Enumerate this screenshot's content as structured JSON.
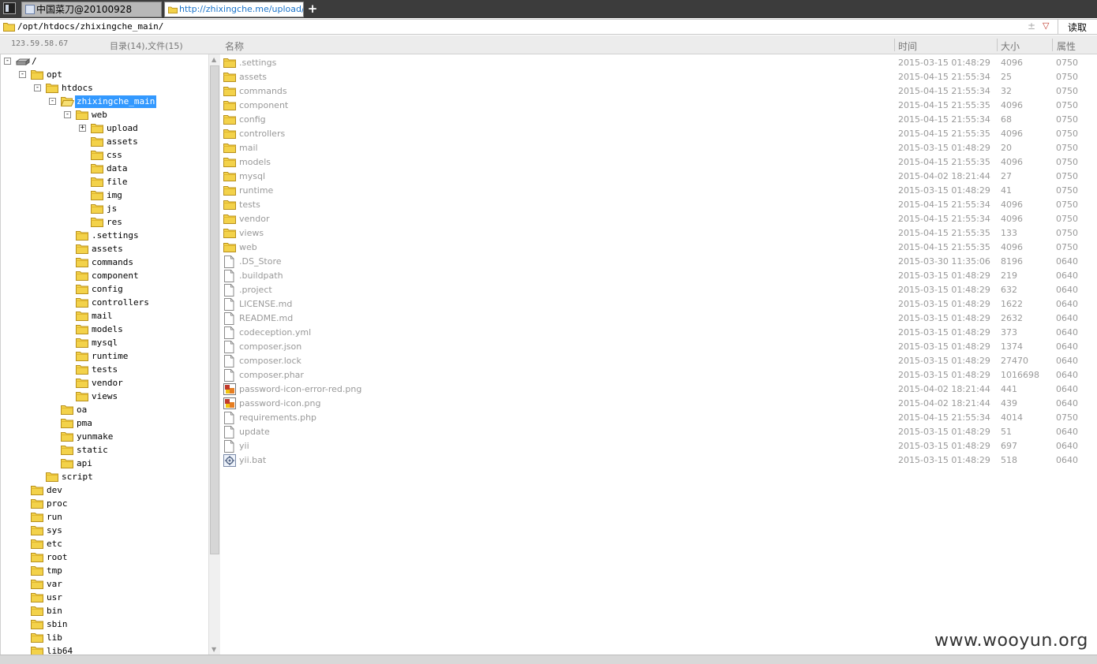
{
  "tabs": [
    {
      "label": "中国菜刀@20100928",
      "active": false
    },
    {
      "label": "http://zhixingche.me/upload/i...",
      "active": true
    }
  ],
  "new_tab_label": "+",
  "address": {
    "path": "/opt/htdocs/zhixingche_main/",
    "read_button": "读取",
    "ctrl_plus": "±",
    "ctrl_dropdown": "▽"
  },
  "left_panel": {
    "ip": "123.59.58.67",
    "counts": "目录(14),文件(15)"
  },
  "tree": [
    {
      "label": "/",
      "expander": "-",
      "icon": "drive"
    },
    {
      "label": "opt",
      "expander": "-",
      "icon": "folder"
    },
    {
      "label": "htdocs",
      "expander": "-",
      "icon": "folder"
    },
    {
      "label": "zhixingche_main",
      "expander": "-",
      "icon": "folder-open",
      "selected": true
    },
    {
      "label": "web",
      "expander": "-",
      "icon": "folder"
    },
    {
      "label": "upload",
      "expander": "+",
      "icon": "folder"
    },
    {
      "label": "assets",
      "expander": "",
      "icon": "folder"
    },
    {
      "label": "css",
      "expander": "",
      "icon": "folder"
    },
    {
      "label": "data",
      "expander": "",
      "icon": "folder"
    },
    {
      "label": "file",
      "expander": "",
      "icon": "folder"
    },
    {
      "label": "img",
      "expander": "",
      "icon": "folder"
    },
    {
      "label": "js",
      "expander": "",
      "icon": "folder"
    },
    {
      "label": "res",
      "expander": "",
      "icon": "folder"
    },
    {
      "label": ".settings",
      "expander": "",
      "icon": "folder"
    },
    {
      "label": "assets",
      "expander": "",
      "icon": "folder"
    },
    {
      "label": "commands",
      "expander": "",
      "icon": "folder"
    },
    {
      "label": "component",
      "expander": "",
      "icon": "folder"
    },
    {
      "label": "config",
      "expander": "",
      "icon": "folder"
    },
    {
      "label": "controllers",
      "expander": "",
      "icon": "folder"
    },
    {
      "label": "mail",
      "expander": "",
      "icon": "folder"
    },
    {
      "label": "models",
      "expander": "",
      "icon": "folder"
    },
    {
      "label": "mysql",
      "expander": "",
      "icon": "folder"
    },
    {
      "label": "runtime",
      "expander": "",
      "icon": "folder"
    },
    {
      "label": "tests",
      "expander": "",
      "icon": "folder"
    },
    {
      "label": "vendor",
      "expander": "",
      "icon": "folder"
    },
    {
      "label": "views",
      "expander": "",
      "icon": "folder"
    },
    {
      "label": "oa",
      "expander": "",
      "icon": "folder"
    },
    {
      "label": "pma",
      "expander": "",
      "icon": "folder"
    },
    {
      "label": "yunmake",
      "expander": "",
      "icon": "folder"
    },
    {
      "label": "static",
      "expander": "",
      "icon": "folder"
    },
    {
      "label": "api",
      "expander": "",
      "icon": "folder"
    },
    {
      "label": "script",
      "expander": "",
      "icon": "folder"
    },
    {
      "label": "dev",
      "expander": "",
      "icon": "folder"
    },
    {
      "label": "proc",
      "expander": "",
      "icon": "folder"
    },
    {
      "label": "run",
      "expander": "",
      "icon": "folder"
    },
    {
      "label": "sys",
      "expander": "",
      "icon": "folder"
    },
    {
      "label": "etc",
      "expander": "",
      "icon": "folder"
    },
    {
      "label": "root",
      "expander": "",
      "icon": "folder"
    },
    {
      "label": "tmp",
      "expander": "",
      "icon": "folder"
    },
    {
      "label": "var",
      "expander": "",
      "icon": "folder"
    },
    {
      "label": "usr",
      "expander": "",
      "icon": "folder"
    },
    {
      "label": "bin",
      "expander": "",
      "icon": "folder"
    },
    {
      "label": "sbin",
      "expander": "",
      "icon": "folder"
    },
    {
      "label": "lib",
      "expander": "",
      "icon": "folder"
    },
    {
      "label": "lib64",
      "expander": "",
      "icon": "folder"
    }
  ],
  "columns": {
    "name": "名称",
    "time": "时间",
    "size": "大小",
    "attr": "属性"
  },
  "files": [
    {
      "name": ".settings",
      "time": "2015-03-15 01:48:29",
      "size": "4096",
      "attr": "0750",
      "icon": "folder"
    },
    {
      "name": "assets",
      "time": "2015-04-15 21:55:34",
      "size": "25",
      "attr": "0750",
      "icon": "folder"
    },
    {
      "name": "commands",
      "time": "2015-04-15 21:55:34",
      "size": "32",
      "attr": "0750",
      "icon": "folder"
    },
    {
      "name": "component",
      "time": "2015-04-15 21:55:35",
      "size": "4096",
      "attr": "0750",
      "icon": "folder"
    },
    {
      "name": "config",
      "time": "2015-04-15 21:55:34",
      "size": "68",
      "attr": "0750",
      "icon": "folder"
    },
    {
      "name": "controllers",
      "time": "2015-04-15 21:55:35",
      "size": "4096",
      "attr": "0750",
      "icon": "folder"
    },
    {
      "name": "mail",
      "time": "2015-03-15 01:48:29",
      "size": "20",
      "attr": "0750",
      "icon": "folder"
    },
    {
      "name": "models",
      "time": "2015-04-15 21:55:35",
      "size": "4096",
      "attr": "0750",
      "icon": "folder"
    },
    {
      "name": "mysql",
      "time": "2015-04-02 18:21:44",
      "size": "27",
      "attr": "0750",
      "icon": "folder"
    },
    {
      "name": "runtime",
      "time": "2015-03-15 01:48:29",
      "size": "41",
      "attr": "0750",
      "icon": "folder"
    },
    {
      "name": "tests",
      "time": "2015-04-15 21:55:34",
      "size": "4096",
      "attr": "0750",
      "icon": "folder"
    },
    {
      "name": "vendor",
      "time": "2015-04-15 21:55:34",
      "size": "4096",
      "attr": "0750",
      "icon": "folder"
    },
    {
      "name": "views",
      "time": "2015-04-15 21:55:35",
      "size": "133",
      "attr": "0750",
      "icon": "folder"
    },
    {
      "name": "web",
      "time": "2015-04-15 21:55:35",
      "size": "4096",
      "attr": "0750",
      "icon": "folder"
    },
    {
      "name": ".DS_Store",
      "time": "2015-03-30 11:35:06",
      "size": "8196",
      "attr": "0640",
      "icon": "file"
    },
    {
      "name": ".buildpath",
      "time": "2015-03-15 01:48:29",
      "size": "219",
      "attr": "0640",
      "icon": "file"
    },
    {
      "name": ".project",
      "time": "2015-03-15 01:48:29",
      "size": "632",
      "attr": "0640",
      "icon": "file"
    },
    {
      "name": "LICENSE.md",
      "time": "2015-03-15 01:48:29",
      "size": "1622",
      "attr": "0640",
      "icon": "file"
    },
    {
      "name": "README.md",
      "time": "2015-03-15 01:48:29",
      "size": "2632",
      "attr": "0640",
      "icon": "file"
    },
    {
      "name": "codeception.yml",
      "time": "2015-03-15 01:48:29",
      "size": "373",
      "attr": "0640",
      "icon": "file"
    },
    {
      "name": "composer.json",
      "time": "2015-03-15 01:48:29",
      "size": "1374",
      "attr": "0640",
      "icon": "file"
    },
    {
      "name": "composer.lock",
      "time": "2015-03-15 01:48:29",
      "size": "27470",
      "attr": "0640",
      "icon": "file"
    },
    {
      "name": "composer.phar",
      "time": "2015-03-15 01:48:29",
      "size": "1016698",
      "attr": "0640",
      "icon": "file"
    },
    {
      "name": "password-icon-error-red.png",
      "time": "2015-04-02 18:21:44",
      "size": "441",
      "attr": "0640",
      "icon": "image"
    },
    {
      "name": "password-icon.png",
      "time": "2015-04-02 18:21:44",
      "size": "439",
      "attr": "0640",
      "icon": "image"
    },
    {
      "name": "requirements.php",
      "time": "2015-04-15 21:55:34",
      "size": "4014",
      "attr": "0750",
      "icon": "file"
    },
    {
      "name": "update",
      "time": "2015-03-15 01:48:29",
      "size": "51",
      "attr": "0640",
      "icon": "file"
    },
    {
      "name": "yii",
      "time": "2015-03-15 01:48:29",
      "size": "697",
      "attr": "0640",
      "icon": "file"
    },
    {
      "name": "yii.bat",
      "time": "2015-03-15 01:48:29",
      "size": "518",
      "attr": "0640",
      "icon": "batch"
    }
  ],
  "watermark": "www.wooyun.org",
  "colors": {
    "folder": "#f3d24a",
    "folder_border": "#b8901c",
    "selection": "#3399ff",
    "active_tab_text": "#1a73c9"
  }
}
